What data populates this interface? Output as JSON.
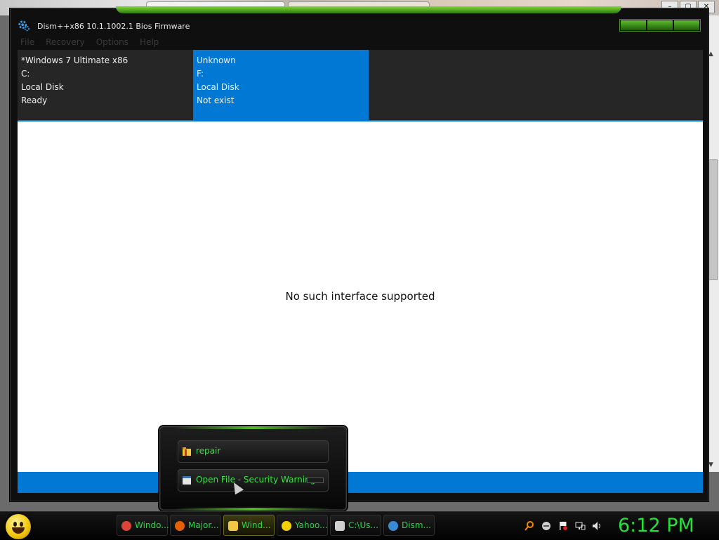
{
  "window": {
    "title": "Dism++x86 10.1.1002.1 Bios Firmware"
  },
  "menu": [
    "File",
    "Recovery",
    "Options",
    "Help"
  ],
  "systems": [
    {
      "name": "*Windows 7 Ultimate x86",
      "drive": "C:",
      "type": "Local Disk",
      "status": "Ready"
    },
    {
      "name": "Unknown",
      "drive": "F:",
      "type": "Local Disk",
      "status": "Not exist"
    }
  ],
  "content": {
    "message": "No such interface supported"
  },
  "jumplist": {
    "items": [
      {
        "label": "repair",
        "icon": "folder-icon"
      },
      {
        "label": "Open File - Security Warning",
        "icon": "window-icon"
      }
    ]
  },
  "taskbar": {
    "tasks": [
      {
        "label": "Windo...",
        "icon": "chrome-icon",
        "color": "#db4437"
      },
      {
        "label": "Major...",
        "icon": "firefox-icon",
        "color": "#e66000"
      },
      {
        "label": "Wind...",
        "icon": "folder-icon",
        "color": "#f2c744",
        "active": true
      },
      {
        "label": "Yahoo...",
        "icon": "yahoo-messenger-icon",
        "color": "#f5d000"
      },
      {
        "label": "C:\\Us...",
        "icon": "7zip-icon",
        "color": "#d0d0d0"
      },
      {
        "label": "Dism...",
        "icon": "gear-icon",
        "color": "#3a8bd6"
      }
    ],
    "clock": "6:12 PM"
  },
  "colors": {
    "accent": "#0078d4",
    "green_text": "#27d64a"
  }
}
